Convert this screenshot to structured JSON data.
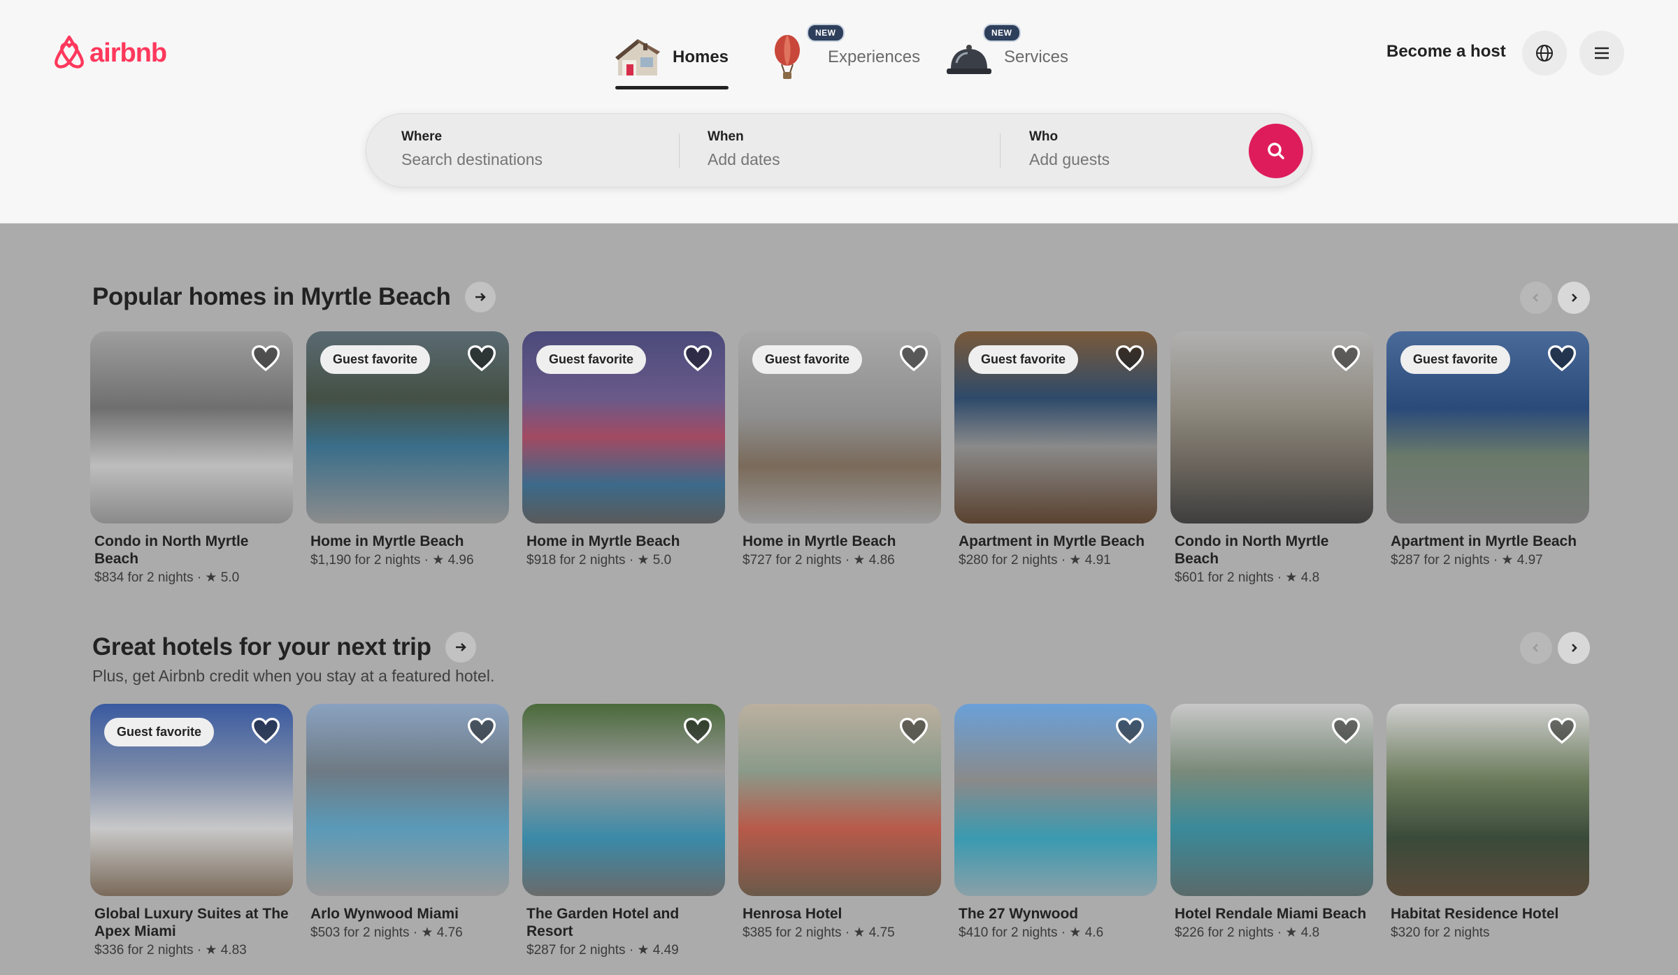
{
  "brand": {
    "name": "airbnb",
    "color": "#ff385c"
  },
  "nav": {
    "tabs": [
      {
        "label": "Homes",
        "icon": "house-icon",
        "active": true,
        "badge": ""
      },
      {
        "label": "Experiences",
        "icon": "hot-air-balloon-icon",
        "active": false,
        "badge": "NEW"
      },
      {
        "label": "Services",
        "icon": "service-bell-icon",
        "active": false,
        "badge": "NEW"
      }
    ],
    "become_host": "Become a host",
    "globe_icon": "globe-icon",
    "menu_icon": "hamburger-menu-icon"
  },
  "search": {
    "where_label": "Where",
    "where_placeholder": "Search destinations",
    "when_label": "When",
    "when_placeholder": "Add dates",
    "who_label": "Who",
    "who_placeholder": "Add guests",
    "button_icon": "search-icon",
    "button_color": "#de1c5c"
  },
  "sections": [
    {
      "title": "Popular homes in Myrtle Beach",
      "subtitle": "",
      "cards": [
        {
          "title": "Condo in North Myrtle Beach",
          "meta": "$834 for 2 nights · ★ 5.0",
          "badge": ""
        },
        {
          "title": "Home in Myrtle Beach",
          "meta": "$1,190 for 2 nights · ★ 4.96",
          "badge": "Guest favorite"
        },
        {
          "title": "Home in Myrtle Beach",
          "meta": "$918 for 2 nights · ★ 5.0",
          "badge": "Guest favorite"
        },
        {
          "title": "Home in Myrtle Beach",
          "meta": "$727 for 2 nights · ★ 4.86",
          "badge": "Guest favorite"
        },
        {
          "title": "Apartment in Myrtle Beach",
          "meta": "$280 for 2 nights · ★ 4.91",
          "badge": "Guest favorite"
        },
        {
          "title": "Condo in North Myrtle Beach",
          "meta": "$601 for 2 nights · ★ 4.8",
          "badge": ""
        },
        {
          "title": "Apartment in Myrtle Beach",
          "meta": "$287 for 2 nights · ★ 4.97",
          "badge": "Guest favorite"
        }
      ]
    },
    {
      "title": "Great hotels for your next trip",
      "subtitle": "Plus, get Airbnb credit when you stay at a featured hotel.",
      "cards": [
        {
          "title": "Global Luxury Suites at The Apex Miami",
          "meta": "$336 for 2 nights · ★ 4.83",
          "badge": "Guest favorite"
        },
        {
          "title": "Arlo Wynwood Miami",
          "meta": "$503 for 2 nights · ★ 4.76",
          "badge": ""
        },
        {
          "title": "The Garden Hotel and Resort",
          "meta": "$287 for 2 nights · ★ 4.49",
          "badge": ""
        },
        {
          "title": "Henrosa Hotel",
          "meta": "$385 for 2 nights · ★ 4.75",
          "badge": ""
        },
        {
          "title": "The 27 Wynwood",
          "meta": "$410 for 2 nights · ★ 4.6",
          "badge": ""
        },
        {
          "title": "Hotel Rendale Miami Beach",
          "meta": "$226 for 2 nights · ★ 4.8",
          "badge": ""
        },
        {
          "title": "Habitat Residence Hotel",
          "meta": "$320 for 2 nights",
          "badge": ""
        }
      ]
    }
  ]
}
